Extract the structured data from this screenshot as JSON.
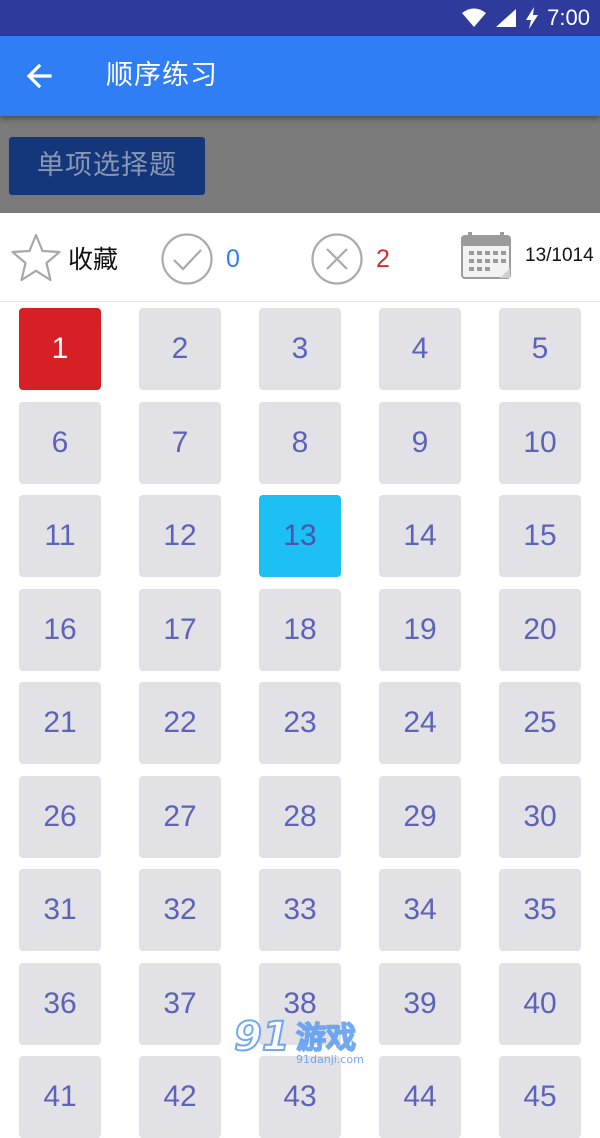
{
  "status_bar": {
    "time": "7:00"
  },
  "app_bar": {
    "title": "顺序练习",
    "back_icon": "arrow-left-icon"
  },
  "question_type": {
    "label": "单项选择题"
  },
  "stats": {
    "favorite_label": "收藏",
    "correct_count": "0",
    "wrong_count": "2",
    "progress": "13/1014"
  },
  "colors": {
    "app_bar": "#2f7ef5",
    "status_bar": "#2e3b9c",
    "wrong_cell": "#d71f26",
    "current_cell": "#1cc0f3",
    "cell": "#e2e2e6",
    "cell_text": "#5c63b8"
  },
  "grid": {
    "cells": [
      "1",
      "2",
      "3",
      "4",
      "5",
      "6",
      "7",
      "8",
      "9",
      "10",
      "11",
      "12",
      "13",
      "14",
      "15",
      "16",
      "17",
      "18",
      "19",
      "20",
      "21",
      "22",
      "23",
      "24",
      "25",
      "26",
      "27",
      "28",
      "29",
      "30",
      "31",
      "32",
      "33",
      "34",
      "35",
      "36",
      "37",
      "38",
      "39",
      "40",
      "41",
      "42",
      "43",
      "44",
      "45"
    ],
    "wrong_index": 0,
    "current_index": 12
  },
  "watermark": {
    "brand": "游戏",
    "site": "91danji.com"
  }
}
